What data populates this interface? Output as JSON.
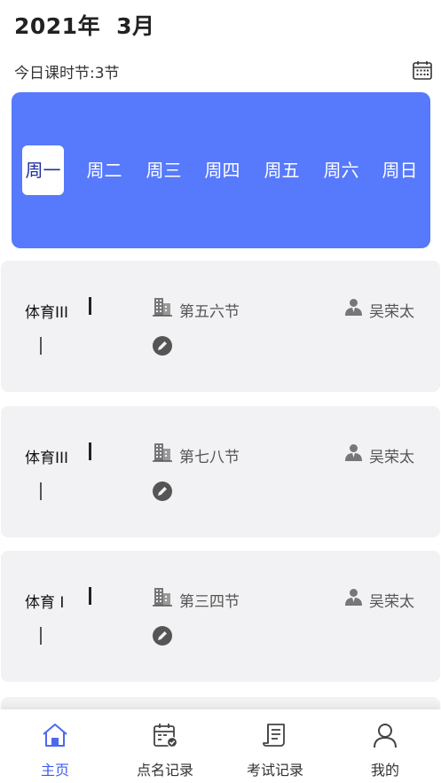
{
  "header": {
    "year": "2021年",
    "month": "3月"
  },
  "today": {
    "label": "今日课时节:3节"
  },
  "colors": {
    "accent": "#5779fb",
    "active_day_text": "#1f2fa0",
    "card_bg": "#f2f2f4",
    "active_tab": "#3d5bf0"
  },
  "week": {
    "days": [
      {
        "label": "周一",
        "active": true
      },
      {
        "label": "周二",
        "active": false
      },
      {
        "label": "周三",
        "active": false
      },
      {
        "label": "周四",
        "active": false
      },
      {
        "label": "周五",
        "active": false
      },
      {
        "label": "周六",
        "active": false
      },
      {
        "label": "周日",
        "active": false
      }
    ]
  },
  "courses": [
    {
      "name": "体育III",
      "section": "第五六节",
      "teacher": "吴荣太",
      "icons": [
        "building-icon",
        "teacher-icon",
        "edit-icon"
      ]
    },
    {
      "name": "体育III",
      "section": "第七八节",
      "teacher": "吴荣太",
      "icons": [
        "building-icon",
        "teacher-icon",
        "edit-icon"
      ]
    },
    {
      "name": "体育 I",
      "section": "第三四节",
      "teacher": "吴荣太",
      "icons": [
        "building-icon",
        "teacher-icon",
        "edit-icon"
      ]
    }
  ],
  "tabbar": {
    "items": [
      {
        "label": "主页",
        "icon": "home-icon",
        "active": true
      },
      {
        "label": "点名记录",
        "icon": "calendar-check-icon",
        "active": false
      },
      {
        "label": "考试记录",
        "icon": "document-icon",
        "active": false
      },
      {
        "label": "我的",
        "icon": "user-icon",
        "active": false
      }
    ]
  }
}
